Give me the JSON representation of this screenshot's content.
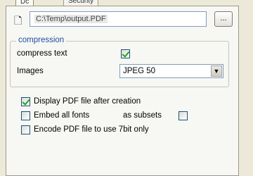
{
  "tabs": [
    {
      "label": "Dc"
    },
    {
      "label": "Security"
    }
  ],
  "path": {
    "value": "C:\\Temp\\output.PDF",
    "browse_label": "..."
  },
  "compression": {
    "title": "compression",
    "compress_text_label": "compress text",
    "compress_text_checked": true,
    "images_label": "Images",
    "images_value": "JPEG 50"
  },
  "options": {
    "display_after": {
      "label": "Display PDF file after creation",
      "checked": true
    },
    "embed_fonts": {
      "label": "Embed all fonts",
      "checked": false
    },
    "as_subsets": {
      "label": "as subsets",
      "checked": false
    },
    "encode_7bit": {
      "label": "Encode PDF file to use 7bit only",
      "checked": false
    }
  },
  "icons": {
    "doc": "file-icon",
    "dropdown": "chevron-down-icon"
  }
}
